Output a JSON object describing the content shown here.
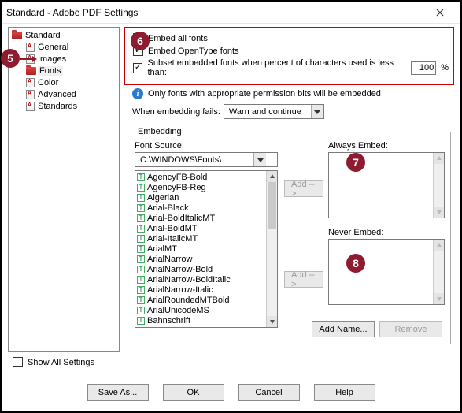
{
  "window": {
    "title": "Standard - Adobe PDF Settings"
  },
  "tree": {
    "root": "Standard",
    "items": [
      "General",
      "Images",
      "Fonts",
      "Color",
      "Advanced",
      "Standards"
    ],
    "selected": "Fonts"
  },
  "fonts": {
    "embed_all_label": "Embed all fonts",
    "embed_all_checked": true,
    "embed_ot_label": "Embed OpenType fonts",
    "embed_ot_checked": true,
    "subset_label": "Subset embedded fonts when percent of characters used is less than:",
    "subset_checked": true,
    "subset_value": "100",
    "subset_suffix": "%",
    "info_text": "Only fonts with appropriate permission bits will be embedded",
    "fails_label": "When embedding fails:",
    "fails_value": "Warn and continue"
  },
  "embedding": {
    "legend": "Embedding",
    "font_source_label": "Font Source:",
    "font_source_value": "C:\\WINDOWS\\Fonts\\",
    "font_list": [
      "AgencyFB-Bold",
      "AgencyFB-Reg",
      "Algerian",
      "Arial-Black",
      "Arial-BoldItalicMT",
      "Arial-BoldMT",
      "Arial-ItalicMT",
      "ArialMT",
      "ArialNarrow",
      "ArialNarrow-Bold",
      "ArialNarrow-BoldItalic",
      "ArialNarrow-Italic",
      "ArialRoundedMTBold",
      "ArialUnicodeMS",
      "Bahnschrift"
    ],
    "always_label": "Always Embed:",
    "never_label": "Never Embed:",
    "add_label": "Add -->",
    "addname_label": "Add Name...",
    "remove_label": "Remove"
  },
  "showall": {
    "label": "Show All Settings",
    "checked": false
  },
  "footer": {
    "saveas": "Save As...",
    "ok": "OK",
    "cancel": "Cancel",
    "help": "Help"
  },
  "annotations": {
    "b5": "5",
    "b6": "6",
    "b7": "7",
    "b8": "8"
  }
}
